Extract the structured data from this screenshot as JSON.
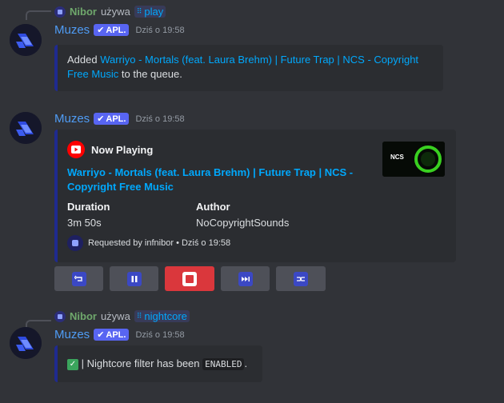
{
  "messages": [
    {
      "reply": {
        "user": "Nibor",
        "verb": "używa",
        "command": "play"
      },
      "author": "Muzes",
      "tag": "APL.",
      "time": "Dziś o 19:58",
      "embed": {
        "prefix": "Added ",
        "link": "Warriyo - Mortals (feat. Laura Brehm) | Future Trap | NCS - Copyright Free Music",
        "suffix": " to the queue."
      }
    },
    {
      "author": "Muzes",
      "tag": "APL.",
      "time": "Dziś o 19:58",
      "embed": {
        "header": "Now Playing",
        "song_line1": "Warriyo - Mortals (feat. Laura Brehm) | Future Trap | NCS -",
        "song_line2": "Copyright Free Music",
        "fields": [
          {
            "name": "Duration",
            "value": "3m 50s"
          },
          {
            "name": "Author",
            "value": "NoCopyrightSounds"
          }
        ],
        "footer": "Requested by infnibor • Dziś o 19:58",
        "thumbnail_text": "NCS"
      },
      "buttons": [
        {
          "icon": "loop-icon",
          "style": "secondary"
        },
        {
          "icon": "pause-icon",
          "style": "secondary"
        },
        {
          "icon": "stop-icon",
          "style": "danger"
        },
        {
          "icon": "skip-icon",
          "style": "secondary"
        },
        {
          "icon": "shuffle-icon",
          "style": "secondary"
        }
      ]
    },
    {
      "reply": {
        "user": "Nibor",
        "verb": "używa",
        "command": "nightcore"
      },
      "author": "Muzes",
      "tag": "APL.",
      "time": "Dziś o 19:58",
      "embed": {
        "text_before": " | Nightcore filter has been ",
        "code": "ENABLED",
        "text_after": "."
      }
    }
  ],
  "colors": {
    "background": "#313338",
    "embed_bg": "#2b2d31",
    "accent": "#5865f2",
    "link": "#00a8fc",
    "danger": "#da373c"
  }
}
